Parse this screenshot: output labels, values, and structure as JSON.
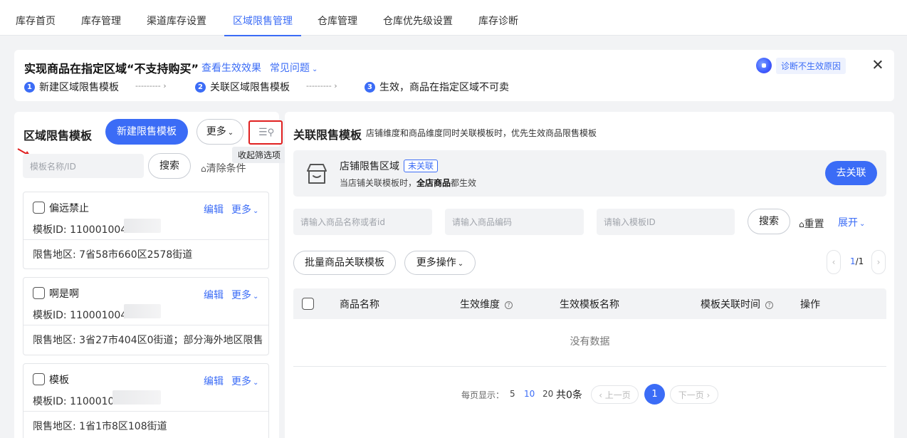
{
  "nav": {
    "tabs": [
      {
        "label": "库存首页"
      },
      {
        "label": "库存管理"
      },
      {
        "label": "渠道库存设置"
      },
      {
        "label": "区域限售管理"
      },
      {
        "label": "仓库管理"
      },
      {
        "label": "仓库优先级设置"
      },
      {
        "label": "库存诊断"
      }
    ],
    "active_index": 3
  },
  "banner": {
    "title": "实现商品在指定区域“不支持购买”",
    "link_effect": "查看生效效果",
    "link_faq": "常见问题",
    "steps": [
      {
        "num": "1",
        "label": "新建区域限售模板"
      },
      {
        "num": "2",
        "label": "关联区域限售模板"
      },
      {
        "num": "3",
        "label": "生效，商品在指定区域不可卖"
      }
    ],
    "step_arrow": "--------- ›",
    "diagnose_label": "诊断不生效原因"
  },
  "left": {
    "title": "区域限售模板",
    "new_button": "新建限售模板",
    "more_button": "更多",
    "filter_icon": "filter-collapse-icon",
    "tooltip": "收起筛选项",
    "search_placeholder": "模板名称/ID",
    "search_button": "搜索",
    "clear_label": "清除条件",
    "cards": [
      {
        "name": "偏远禁止",
        "edit": "编辑",
        "more": "更多",
        "template_id": "模板ID: 1100010049",
        "region": "限售地区: 7省58市660区2578街道"
      },
      {
        "name": "啊是啊",
        "edit": "编辑",
        "more": "更多",
        "template_id": "模板ID: 1100010049",
        "region": "限售地区: 3省27市404区0街道；部分海外地区限售"
      },
      {
        "name": "模板",
        "edit": "编辑",
        "more": "更多",
        "template_id": "模板ID: 1100010",
        "region": "限售地区: 1省1市8区108街道"
      }
    ]
  },
  "right": {
    "title": "关联限售模板",
    "subtitle": "店铺维度和商品维度同时关联模板时，优先生效商品限售模板",
    "store": {
      "title": "店铺限售区域",
      "badge": "未关联",
      "desc_prefix": "当店铺关联模板时，",
      "desc_bold": "全店商品",
      "desc_suffix": "都生效",
      "link_button": "去关联"
    },
    "filters": {
      "product_placeholder": "请输入商品名称或者id",
      "code_placeholder": "请输入商品编码",
      "template_placeholder": "请输入模板ID",
      "search_button": "搜索",
      "reset_label": "重置",
      "expand_label": "展开"
    },
    "batch_button": "批量商品关联模板",
    "more_ops_button": "更多操作",
    "mini_pager": {
      "current": "1",
      "total": "/1"
    },
    "table": {
      "columns": [
        "商品名称",
        "生效维度",
        "生效模板名称",
        "模板关联时间",
        "操作"
      ],
      "empty_text": "没有数据"
    },
    "pagination": {
      "per_page_label": "每页显示：",
      "sizes": [
        "5",
        "10",
        "20"
      ],
      "selected_size": "10",
      "total": "共0条",
      "prev": "‹ 上一页",
      "current": "1",
      "next": "下一页 ›"
    }
  },
  "colors": {
    "accent": "#3b6cf6",
    "highlight_box": "#e02020"
  }
}
